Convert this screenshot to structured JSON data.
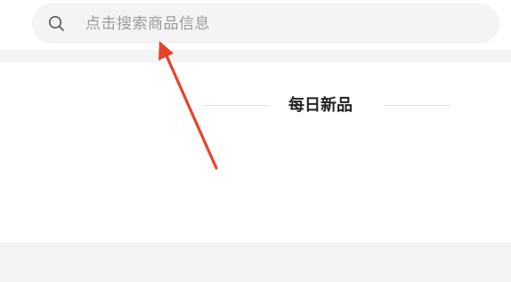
{
  "search": {
    "placeholder": "点击搜索商品信息",
    "icon": "search-icon"
  },
  "daily_new": {
    "title": "每日新品"
  },
  "annotation": {
    "icon": "red-arrow-icon",
    "color": "#e8412c"
  },
  "colors": {
    "background": "#ffffff",
    "band": "#f4f4f4",
    "placeholder": "#9b9b9b",
    "title": "#222222",
    "divider": "#e2e2e2"
  }
}
